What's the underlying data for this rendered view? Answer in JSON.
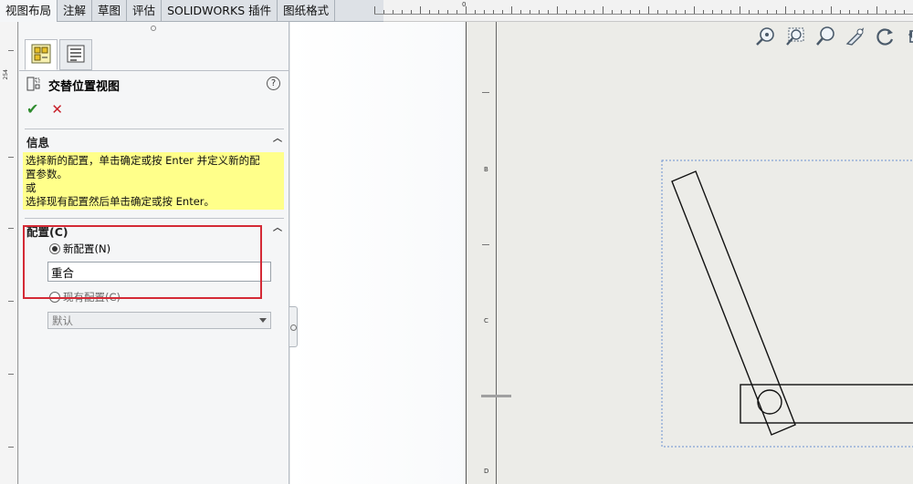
{
  "command_manager": {
    "tabs": [
      {
        "label": "视图布局",
        "active": true
      },
      {
        "label": "注解",
        "active": false
      },
      {
        "label": "草图",
        "active": false
      },
      {
        "label": "评估",
        "active": false
      },
      {
        "label": "SOLIDWORKS 插件",
        "active": false
      },
      {
        "label": "图纸格式",
        "active": false
      }
    ]
  },
  "rulers": {
    "top_zero_label": "0",
    "left_label": "254"
  },
  "property_manager": {
    "tabs": [
      {
        "icon": "property-manager-icon",
        "active": true
      },
      {
        "icon": "configuration-manager-icon",
        "active": false
      }
    ],
    "title": "交替位置视图",
    "title_icon": "alternate-position-view-icon",
    "help_label": "?",
    "ok_icon": "checkmark-icon",
    "cancel_icon": "close-icon",
    "info_group": {
      "heading": "信息",
      "lines": [
        "选择新的配置，单击确定或按 Enter 并定义新的配",
        "置参数。",
        "或",
        "选择现有配置然后单击确定或按 Enter。"
      ]
    },
    "config_group": {
      "heading": "配置(C)",
      "new_config_label": "新配置(N)",
      "new_config_selected": true,
      "new_config_value": "重合",
      "existing_config_label": "现有配置(C)",
      "existing_config_selected": false,
      "existing_config_value": "默认"
    }
  },
  "sheet": {
    "zone_labels": [
      "B",
      "C",
      "D"
    ]
  },
  "view_toolbar": {
    "icons": [
      "zoom-to-fit-icon",
      "zoom-to-area-icon",
      "zoom-in-out-icon",
      "pan-icon",
      "rotate-icon",
      "previous-view-icon"
    ]
  },
  "colors": {
    "info_background": "#ffff8a",
    "highlight_border": "#d42a36",
    "ok_green": "#2e8b2e",
    "cancel_red": "#c8202a"
  }
}
